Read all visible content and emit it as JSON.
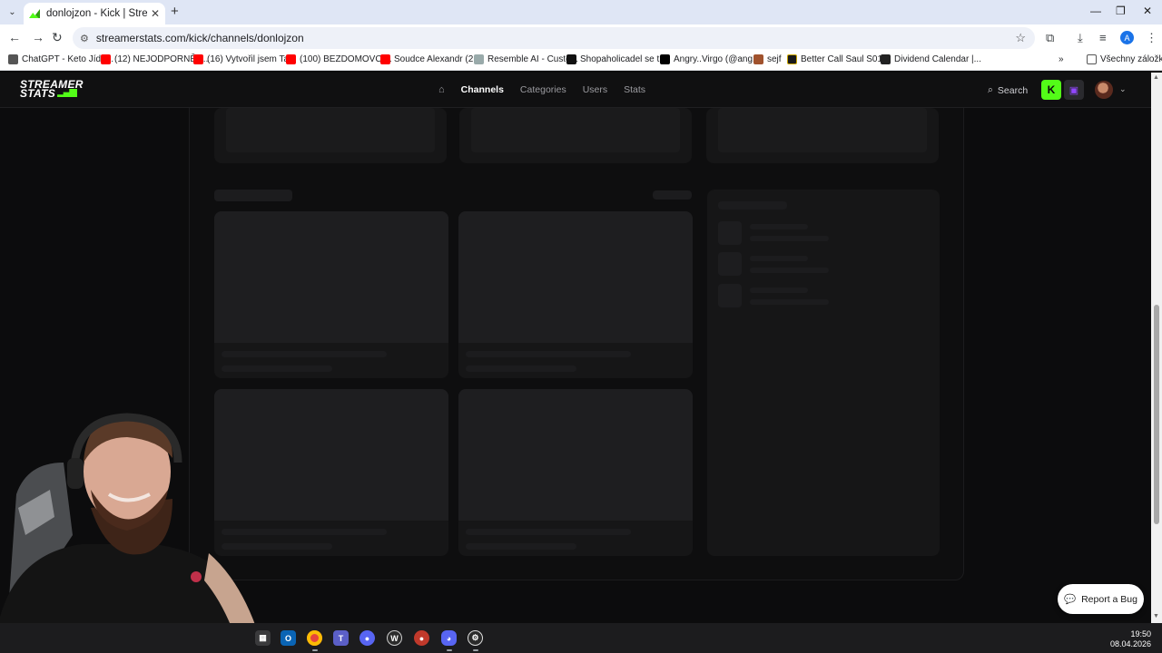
{
  "browser": {
    "tab_title": "donlojzon - Kick | StreamerStats",
    "tab_close": "✕",
    "new_tab": "+",
    "url": "streamerstats.com/kick/channels/donlojzon",
    "profile_initial": "A",
    "bookmarks": [
      {
        "label": "ChatGPT - Keto Jíde...",
        "icon": "ic-gpt"
      },
      {
        "label": "(12) NEJODPORNĚJ...",
        "icon": "ic-yt"
      },
      {
        "label": "(16) Vytvořil jsem Ta...",
        "icon": "ic-yt"
      },
      {
        "label": "(100) BEZDOMOVCI...",
        "icon": "ic-yt"
      },
      {
        "label": "Soudce Alexandr (2...",
        "icon": "ic-yt"
      },
      {
        "label": "Resemble AI - Custo...",
        "icon": "ic-res"
      },
      {
        "label": "Shopaholicadel se t...",
        "icon": "ic-x"
      },
      {
        "label": "Angry..Virgo (@ang...",
        "icon": "ic-tt"
      },
      {
        "label": "sejf",
        "icon": "ic-deer"
      },
      {
        "label": "Better Call Saul S01...",
        "icon": "ic-bcs"
      },
      {
        "label": "Dividend Calendar |...",
        "icon": "ic-div"
      }
    ],
    "bookmarks_overflow": "»",
    "all_bookmarks": "Všechny záložky"
  },
  "site": {
    "logo_line1": "STREAMER",
    "logo_line2": "STATS",
    "nav": [
      "Channels",
      "Categories",
      "Users",
      "Stats"
    ],
    "active_nav": "Channels",
    "search_label": "Search",
    "kick_glyph": "K"
  },
  "report_bug": "Report a Bug",
  "taskbar": {
    "time": "19:50",
    "date": "08.04.2026"
  },
  "colors": {
    "kick_green": "#53fc18",
    "twitch_purple": "#9147ff",
    "page_bg": "#0b0b0c",
    "skeleton": "#161617"
  }
}
